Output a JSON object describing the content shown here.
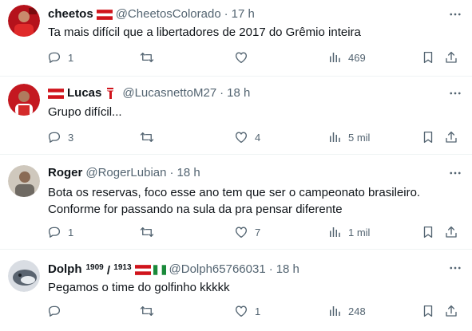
{
  "tweets": [
    {
      "display_name": "cheetos",
      "handle": "@CheetosColorado",
      "dot": "·",
      "time": "17 h",
      "text": "Ta mais difícil que a libertadores de 2017 do Grêmio inteira",
      "stats": {
        "replies": "1",
        "reposts": "",
        "likes": "",
        "views": "469"
      }
    },
    {
      "display_name": "Lucas",
      "handle": "@LucasnettoM27",
      "dot": "·",
      "time": "18 h",
      "text": "Grupo difícil...",
      "stats": {
        "replies": "3",
        "reposts": "",
        "likes": "4",
        "views": "5 mil"
      }
    },
    {
      "display_name": "Roger",
      "handle": "@RogerLubian",
      "dot": "·",
      "time": "18 h",
      "text_lines": [
        "Bota os reservas, foco esse ano tem que ser o campeonato brasileiro.",
        "Conforme for passando na sula da pra pensar diferente"
      ],
      "stats": {
        "replies": "1",
        "reposts": "",
        "likes": "7",
        "views": "1 mil"
      }
    },
    {
      "display_name": "Dolph",
      "name_suffix_1": "1909",
      "name_suffix_sep": " / ",
      "name_suffix_2": "1913",
      "handle": "@Dolph65766031",
      "dot": "·",
      "time": "18 h",
      "text": "Pegamos o time do golfinho kkkkk",
      "stats": {
        "replies": "",
        "reposts": "",
        "likes": "1",
        "views": "248"
      }
    }
  ],
  "colors": {
    "text": "#0f1419",
    "secondary": "#536471",
    "divider": "#eff3f4",
    "flag_red": "#d0141c"
  },
  "icons": [
    "more-icon",
    "reply-icon",
    "repost-icon",
    "like-icon",
    "views-icon",
    "bookmark-icon",
    "share-icon"
  ]
}
